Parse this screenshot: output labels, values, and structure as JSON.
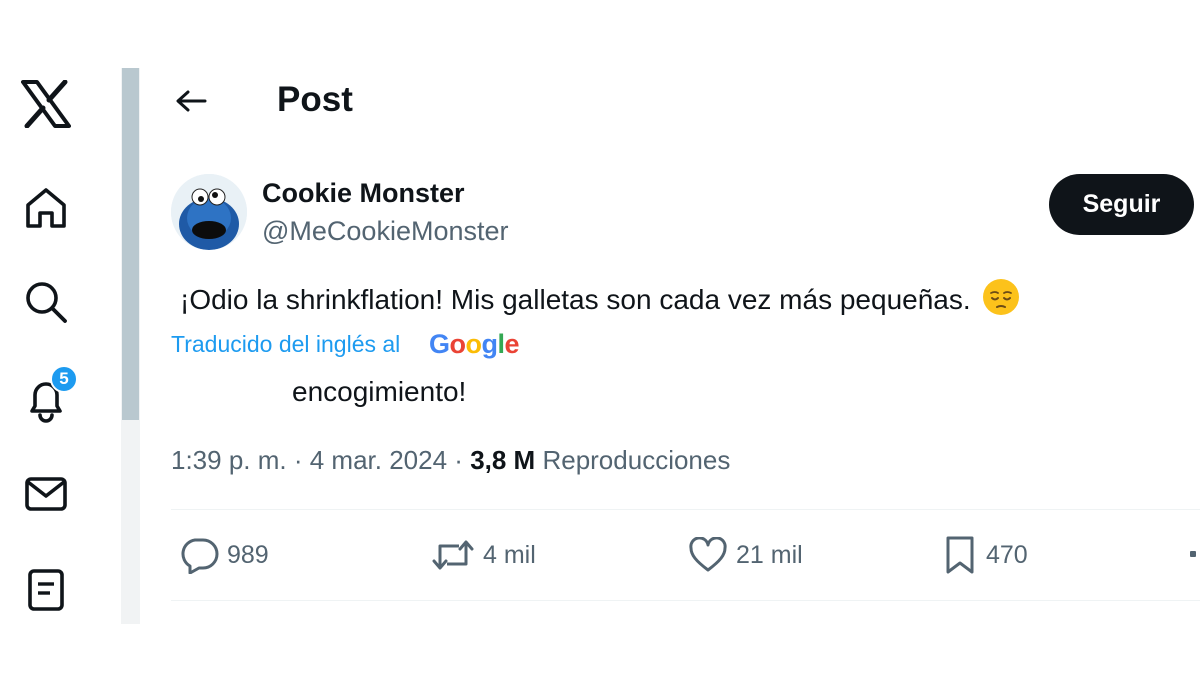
{
  "nav": {
    "icons": [
      "x-logo-icon",
      "home-icon",
      "search-icon",
      "notifications-icon",
      "messages-icon",
      "lists-icon"
    ],
    "notifications_badge": "5"
  },
  "header": {
    "title": "Post"
  },
  "post": {
    "author_name": "Cookie Monster",
    "author_handle": "@MeCookieMonster",
    "follow_label": "Seguir",
    "text_part1": "¡Odio la shrinkflation! Mis galletas son cada vez más pequeñas.",
    "emoji": "pensive-face-emoji",
    "translated_label": "Traducido del inglés al",
    "google_label": "Google",
    "text_part2": "encogimiento!",
    "time": "1:39 p. m.",
    "date": "4 mar. 2024",
    "views_count": "3,8 M",
    "views_label": "Reproducciones"
  },
  "actions": {
    "replies": "989",
    "reposts": "4 mil",
    "likes": "21 mil",
    "bookmarks": "470"
  },
  "colors": {
    "accent": "#1d9bf0",
    "text": "#0f1419",
    "secondary": "#536471",
    "button_bg": "#0f1419"
  }
}
